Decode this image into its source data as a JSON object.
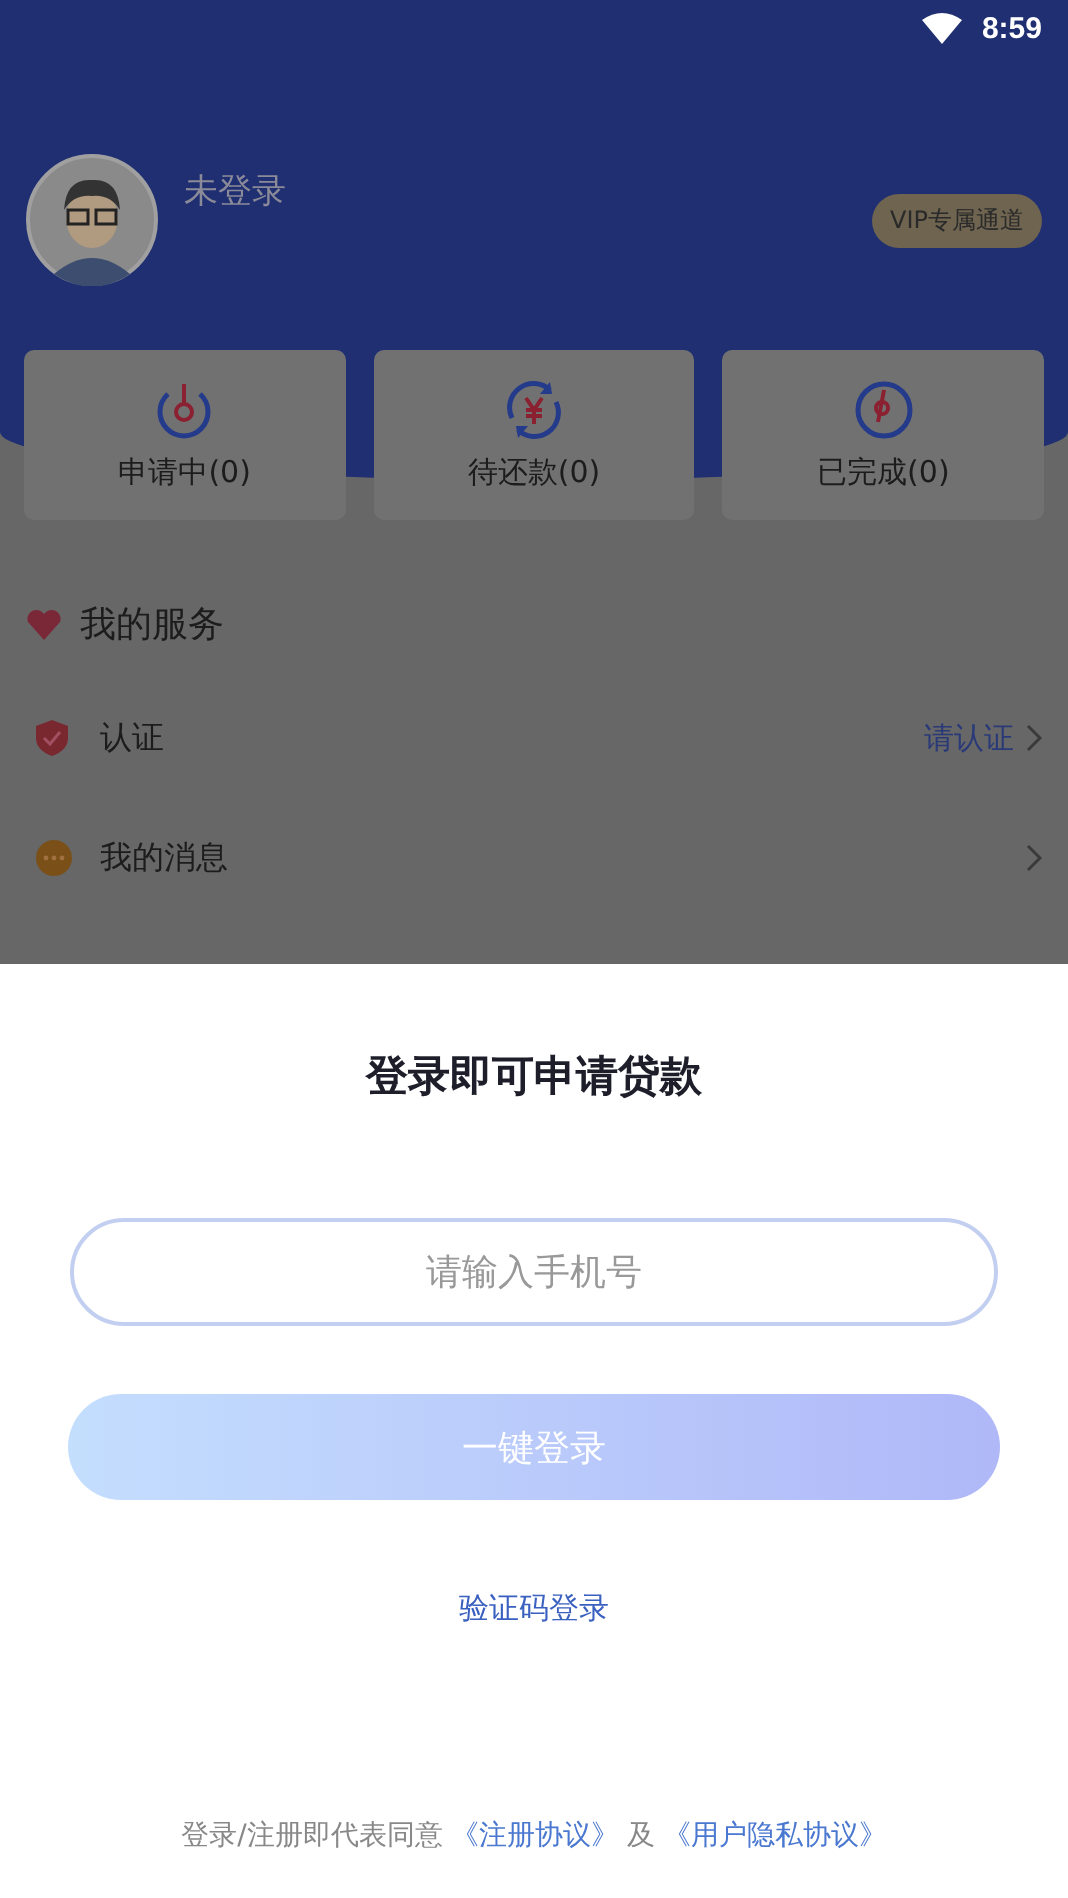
{
  "status_bar": {
    "time": "8:59"
  },
  "profile": {
    "name": "未登录",
    "vip_badge": "VIP专属通道"
  },
  "order_cards": [
    {
      "kind": "applying",
      "label": "申请中(0)"
    },
    {
      "kind": "repaying",
      "label": "待还款(0)"
    },
    {
      "kind": "done",
      "label": "已完成(0)"
    }
  ],
  "services": {
    "title": "我的服务",
    "items": [
      {
        "kind": "verify",
        "label": "认证",
        "action": "请认证"
      },
      {
        "kind": "messages",
        "label": "我的消息"
      }
    ]
  },
  "login_sheet": {
    "title": "登录即可申请贷款",
    "phone_field": {
      "placeholder": "请输入手机号"
    },
    "login_button": {
      "label": "一键登录",
      "disabled": true
    },
    "sms_link": "验证码登录",
    "agreement": {
      "text": "登录/注册即代表同意",
      "links": [
        "《注册协议》",
        "《用户隐私协议》"
      ],
      "joiner": "及"
    }
  }
}
